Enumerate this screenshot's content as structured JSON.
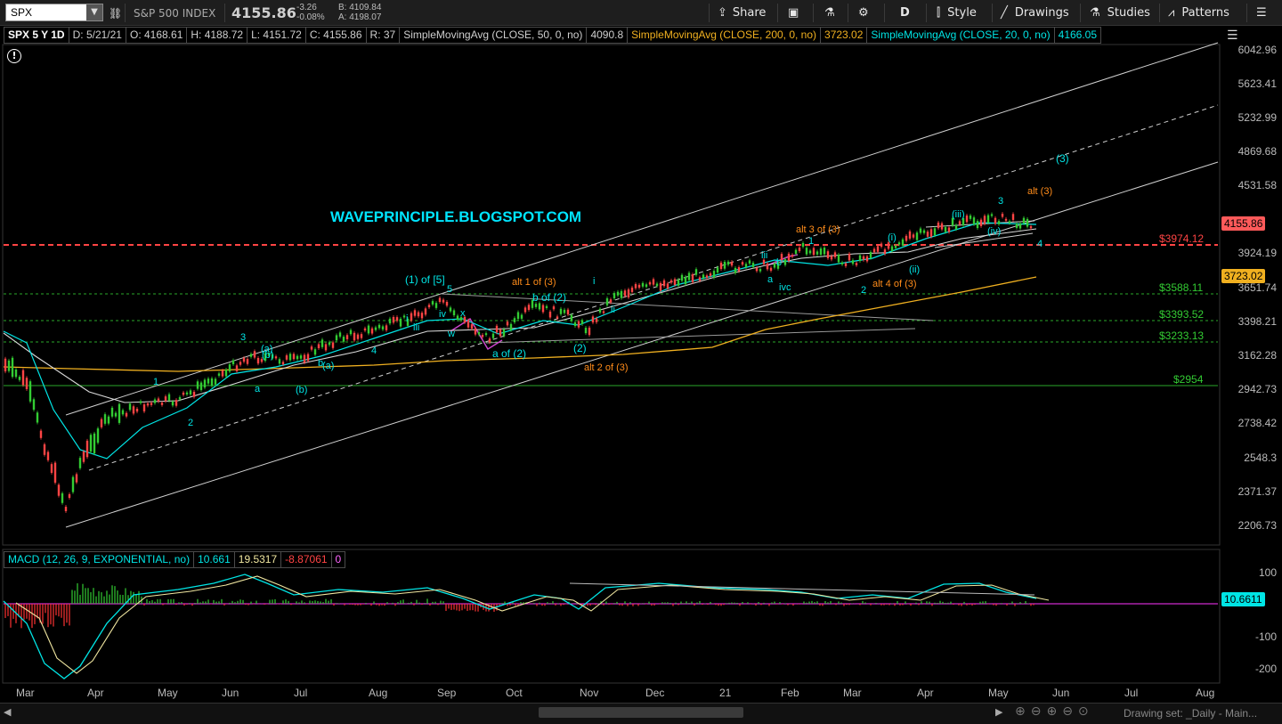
{
  "toolbar": {
    "symbol": "SPX",
    "index_name": "S&P 500 INDEX",
    "last_price": "4155.86",
    "change": "-3.26",
    "change_pct": "-0.08%",
    "bid": "B: 4109.84",
    "ask": "A: 4198.07",
    "share": "Share",
    "period": "D",
    "style": "Style",
    "drawings": "Drawings",
    "studies": "Studies",
    "patterns": "Patterns"
  },
  "info": {
    "title": "SPX 5 Y 1D",
    "date": "D: 5/21/21",
    "open": "O: 4168.61",
    "high": "H: 4188.72",
    "low": "L: 4151.72",
    "close": "C: 4155.86",
    "range": "R: 37",
    "sma50_label": "SimpleMovingAvg (CLOSE, 50, 0, no)",
    "sma50_value": "4090.8",
    "sma200_label": "SimpleMovingAvg (CLOSE, 200, 0, no)",
    "sma200_value": "3723.02",
    "sma20_label": "SimpleMovingAvg (CLOSE, 20, 0, no)",
    "sma20_value": "4166.05"
  },
  "watermark": "WAVEPRINCIPLE.BLOGSPOT.COM",
  "y_axis": [
    "6042.96",
    "5623.41",
    "5232.99",
    "4869.68",
    "4531.58",
    "3924.19",
    "3651.74",
    "3398.21",
    "3162.28",
    "2942.73",
    "2738.42",
    "2548.3",
    "2371.37",
    "2206.73"
  ],
  "price_tags": {
    "last": "4155.86",
    "sma200": "3723.02"
  },
  "levels": [
    {
      "label": "$3974.12",
      "color": "#ff4444"
    },
    {
      "label": "$3588.11",
      "color": "#33cc33"
    },
    {
      "label": "$3393.52",
      "color": "#33cc33"
    },
    {
      "label": "$3233.13",
      "color": "#33cc33"
    },
    {
      "label": "$2954",
      "color": "#33cc33"
    }
  ],
  "x_axis": [
    "Mar",
    "Apr",
    "May",
    "Jun",
    "Jul",
    "Aug",
    "Sep",
    "Oct",
    "Nov",
    "Dec",
    "21",
    "Feb",
    "Mar",
    "Apr",
    "May",
    "Jun",
    "Jul",
    "Aug"
  ],
  "wave_labels": [
    {
      "t": "1",
      "c": "#00e5e5"
    },
    {
      "t": "2",
      "c": "#00e5e5"
    },
    {
      "t": "3",
      "c": "#00e5e5"
    },
    {
      "t": "(a)",
      "c": "#00e5e5"
    },
    {
      "t": "a",
      "c": "#00e5e5"
    },
    {
      "t": "(b)",
      "c": "#00e5e5"
    },
    {
      "t": "b",
      "c": "#00e5e5"
    },
    {
      "t": "(a)",
      "c": "#00e5e5"
    },
    {
      "t": "(b)",
      "c": "#00e5e5"
    },
    {
      "t": "4",
      "c": "#00e5e5"
    },
    {
      "t": "(1) of [5]",
      "c": "#00e5e5"
    },
    {
      "t": "5",
      "c": "#00e5e5"
    },
    {
      "t": "i",
      "c": "#00e5e5"
    },
    {
      "t": "iii",
      "c": "#00e5e5"
    },
    {
      "t": "iv",
      "c": "#00e5e5"
    },
    {
      "t": "w",
      "c": "#00e5e5"
    },
    {
      "t": "x",
      "c": "#00e5e5"
    },
    {
      "t": "a of (2)",
      "c": "#00e5e5"
    },
    {
      "t": "b of (2)",
      "c": "#00e5e5"
    },
    {
      "t": "(2)",
      "c": "#00e5e5"
    },
    {
      "t": "alt 1 of  (3)",
      "c": "#ff8c1a"
    },
    {
      "t": "alt 2 of  (3)",
      "c": "#ff8c1a"
    },
    {
      "t": "i",
      "c": "#00e5e5"
    },
    {
      "t": "ii",
      "c": "#00e5e5"
    },
    {
      "t": "iii",
      "c": "#00e5e5"
    },
    {
      "t": "a",
      "c": "#00e5e5"
    },
    {
      "t": "b",
      "c": "#00e5e5"
    },
    {
      "t": "ivc",
      "c": "#00e5e5"
    },
    {
      "t": "alt 3 of  (3)",
      "c": "#ff8c1a"
    },
    {
      "t": "1",
      "c": "#00e5e5"
    },
    {
      "t": "2",
      "c": "#00e5e5"
    },
    {
      "t": "alt 4 of  (3)",
      "c": "#ff8c1a"
    },
    {
      "t": "(i)",
      "c": "#00e5e5"
    },
    {
      "t": "(ii)",
      "c": "#00e5e5"
    },
    {
      "t": "(iii)",
      "c": "#00e5e5"
    },
    {
      "t": "(iv)",
      "c": "#00e5e5"
    },
    {
      "t": "3",
      "c": "#00e5e5"
    },
    {
      "t": "4",
      "c": "#00e5e5"
    },
    {
      "t": "alt  (3)",
      "c": "#ff8c1a"
    },
    {
      "t": "(3)",
      "c": "#00e5e5"
    }
  ],
  "macd": {
    "label": "MACD (12, 26, 9, EXPONENTIAL, no)",
    "value": "10.661",
    "avg": "19.5317",
    "diff": "-8.87061",
    "zero": "0",
    "tag": "10.6611",
    "y_axis": [
      "100",
      "-100",
      "-200"
    ]
  },
  "bottom": {
    "drawing_set": "Drawing set:  _Daily - Main..."
  },
  "colors": {
    "sma50": "#e0e0e0",
    "sma200": "#f0b020",
    "sma20": "#00e5e5",
    "candle_up": "#33cc33",
    "candle_down": "#ff4444"
  }
}
